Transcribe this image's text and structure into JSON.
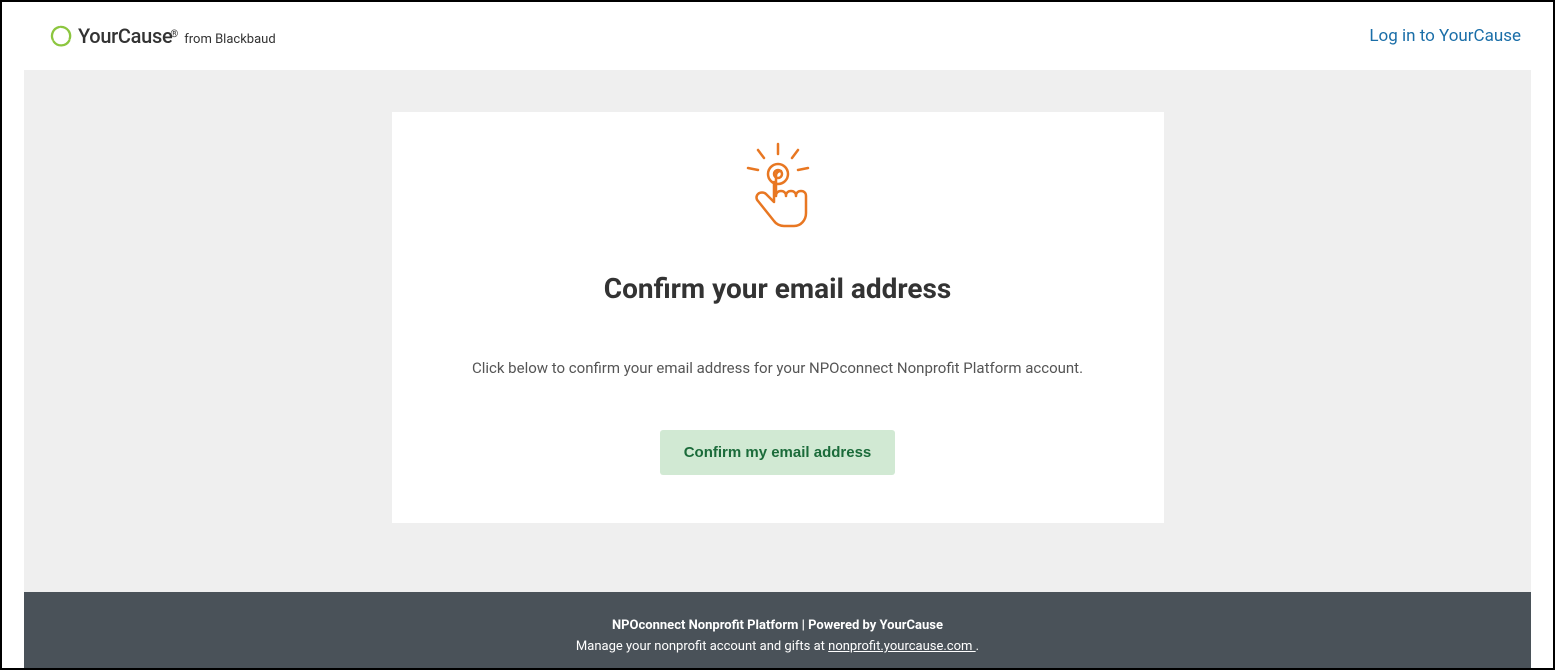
{
  "header": {
    "brand_primary": "YourCause",
    "brand_reg": "®",
    "brand_secondary": "from Blackbaud",
    "login_link": "Log in to YourCause"
  },
  "card": {
    "title": "Confirm your email address",
    "body": "Click below to confirm your email address for your NPOconnect Nonprofit Platform account.",
    "button_label": "Confirm my email address"
  },
  "footer": {
    "line1": "NPOconnect Nonprofit Platform | Powered by YourCause",
    "line2_prefix": "Manage your nonprofit account and gifts at ",
    "line2_link": "nonprofit.yourcause.com ",
    "line2_suffix": "."
  },
  "colors": {
    "brand_green": "#8cc63f",
    "orange": "#e87722",
    "button_bg": "#d1e9d3",
    "button_text": "#1b6b3a",
    "footer_bg": "#4a5259",
    "link_blue": "#1a6ea8"
  }
}
